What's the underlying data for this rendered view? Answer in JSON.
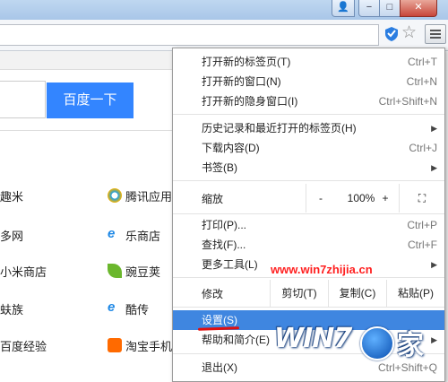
{
  "window": {
    "controls": {
      "user": "👤",
      "minimize": "−",
      "maximize": "□",
      "close": "✕"
    }
  },
  "toolbar": {
    "shield_icon": "shield-icon",
    "star_icon": "☆",
    "menu_icon": "hamburger-menu-icon"
  },
  "page": {
    "baidu_button": "百度一下",
    "links": [
      {
        "label": "趣米",
        "icon": "quumi-icon"
      },
      {
        "label": "多网",
        "icon": "duowang-icon"
      },
      {
        "label": "小米商店",
        "icon": "xiaomi-store-icon"
      },
      {
        "label": "蚨族",
        "icon": "fuzu-icon"
      },
      {
        "label": "百度经验",
        "icon": "baidu-jingyan-icon"
      },
      {
        "label": "腾讯应用",
        "icon": "tencent-app-icon",
        "color": "#1aa0e8"
      },
      {
        "label": "乐商店",
        "icon": "le-store-icon",
        "color": "#1e88e5"
      },
      {
        "label": "豌豆荚",
        "icon": "wandoujia-icon",
        "color": "#6bb72d"
      },
      {
        "label": "酷传",
        "icon": "kuchuan-icon",
        "color": "#1e88e5"
      },
      {
        "label": "淘宝手机",
        "icon": "taobao-mobile-icon",
        "color": "#ff6a00"
      }
    ]
  },
  "menu": {
    "items": [
      {
        "label": "打开新的标签页(T)",
        "shortcut": "Ctrl+T"
      },
      {
        "label": "打开新的窗口(N)",
        "shortcut": "Ctrl+N"
      },
      {
        "label": "打开新的隐身窗口(I)",
        "shortcut": "Ctrl+Shift+N"
      },
      {
        "label": "历史记录和最近打开的标签页(H)",
        "shortcut": "▶"
      },
      {
        "label": "下载内容(D)",
        "shortcut": "Ctrl+J"
      },
      {
        "label": "书签(B)",
        "shortcut": "▶"
      },
      {
        "label": "打印(P)...",
        "shortcut": "Ctrl+P"
      },
      {
        "label": "查找(F)...",
        "shortcut": "Ctrl+F"
      },
      {
        "label": "更多工具(L)",
        "shortcut": "▶"
      },
      {
        "label": "设置(S)",
        "shortcut": ""
      },
      {
        "label": "帮助和简介(E)",
        "shortcut": "▶"
      },
      {
        "label": "退出(X)",
        "shortcut": "Ctrl+Shift+Q"
      }
    ],
    "zoom": {
      "label": "缩放",
      "minus": "-",
      "value": "100%",
      "plus": "+",
      "fullscreen": "⛶"
    },
    "edit": {
      "label": "修改",
      "cut": "剪切(T)",
      "copy": "复制(C)",
      "paste": "粘贴(P)"
    }
  },
  "watermark": {
    "url": "www.win7zhijia.cn",
    "logo_text": "WIN7",
    "logo_suffix": "家"
  },
  "colors": {
    "accent": "#3f86e0",
    "baidu": "#3385ff",
    "watermark": "#ff2020"
  }
}
